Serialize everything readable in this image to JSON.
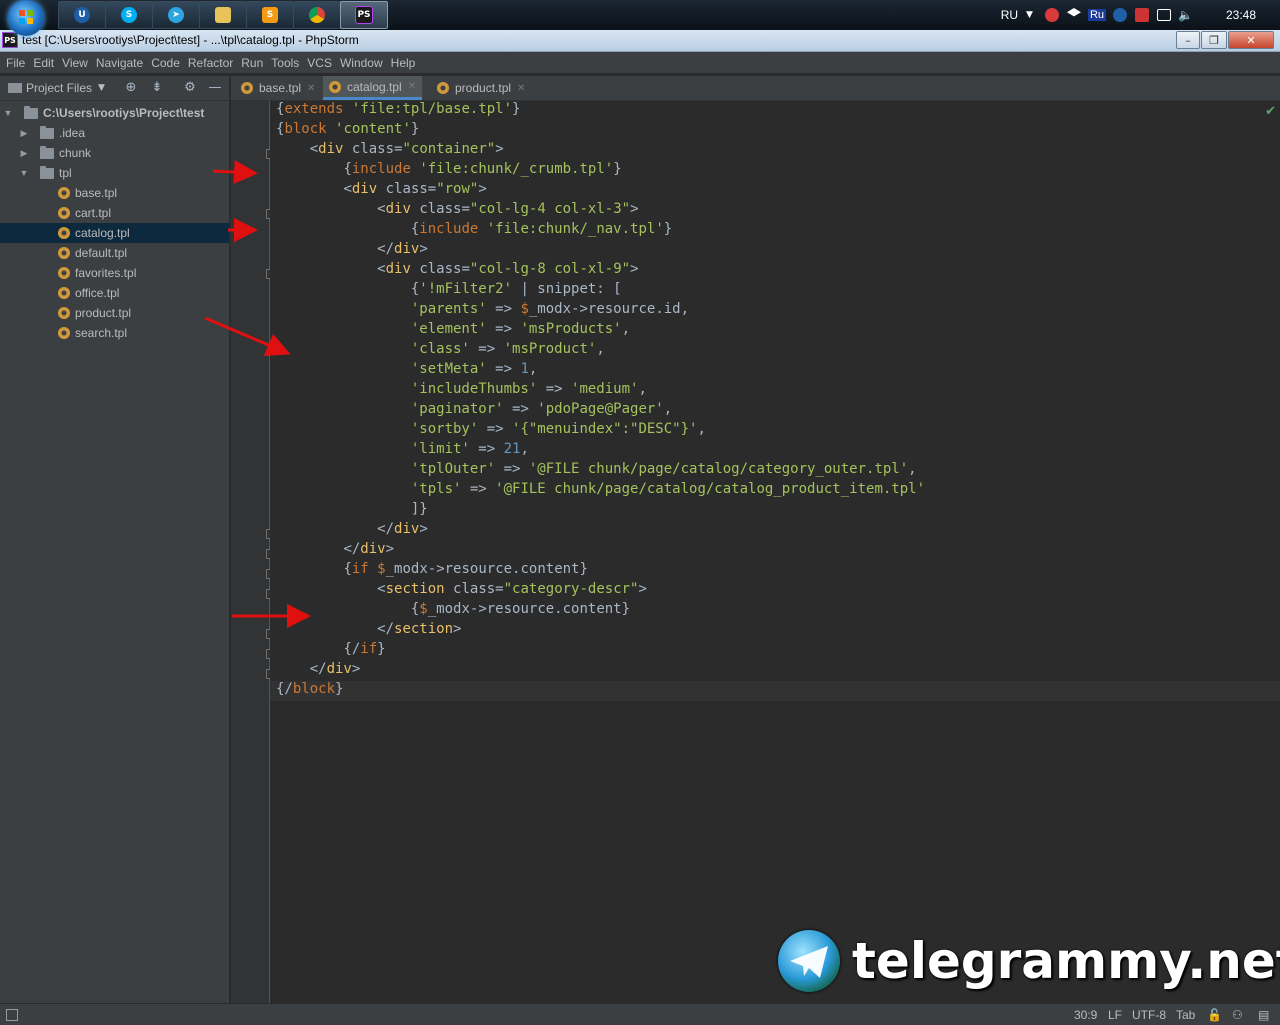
{
  "taskbar": {
    "language": "RU",
    "clock": "23:48",
    "ru_indicator": "Ru",
    "apps": [
      {
        "name": "uplay",
        "label": ""
      },
      {
        "name": "skype",
        "label": "S"
      },
      {
        "name": "telegram",
        "label": ""
      },
      {
        "name": "explorer",
        "label": ""
      },
      {
        "name": "sublime",
        "label": ""
      },
      {
        "name": "chrome",
        "label": ""
      },
      {
        "name": "phpstorm",
        "label": "PS"
      }
    ]
  },
  "window": {
    "title": "test [C:\\Users\\rootiys\\Project\\test] - ...\\tpl\\catalog.tpl - PhpStorm",
    "icon_label": "PS"
  },
  "menu": [
    "File",
    "Edit",
    "View",
    "Navigate",
    "Code",
    "Refactor",
    "Run",
    "Tools",
    "VCS",
    "Window",
    "Help"
  ],
  "project_panel": {
    "title": "Project Files",
    "tree": [
      {
        "label": "C:\\Users\\rootiys\\Project\\test",
        "type": "root"
      },
      {
        "label": ".idea",
        "type": "folder"
      },
      {
        "label": "chunk",
        "type": "folder"
      },
      {
        "label": "tpl",
        "type": "folder-open"
      },
      {
        "label": "base.tpl",
        "type": "file"
      },
      {
        "label": "cart.tpl",
        "type": "file"
      },
      {
        "label": "catalog.tpl",
        "type": "file",
        "selected": true
      },
      {
        "label": "default.tpl",
        "type": "file"
      },
      {
        "label": "favorites.tpl",
        "type": "file"
      },
      {
        "label": "office.tpl",
        "type": "file"
      },
      {
        "label": "product.tpl",
        "type": "file"
      },
      {
        "label": "search.tpl",
        "type": "file"
      }
    ]
  },
  "tabs": [
    {
      "label": "base.tpl",
      "active": false
    },
    {
      "label": "catalog.tpl",
      "active": true
    },
    {
      "label": "product.tpl",
      "active": false
    }
  ],
  "code": [
    "{extends 'file:tpl/base.tpl'}",
    "{block 'content'}",
    "    <div class=\"container\">",
    "        {include 'file:chunk/_crumb.tpl'}",
    "        <div class=\"row\">",
    "            <div class=\"col-lg-4 col-xl-3\">",
    "                {include 'file:chunk/_nav.tpl'}",
    "            </div>",
    "            <div class=\"col-lg-8 col-xl-9\">",
    "                {'!mFilter2' | snippet: [",
    "                'parents' => $_modx->resource.id,",
    "                'element' => 'msProducts',",
    "                'class' => 'msProduct',",
    "                'setMeta' => 1,",
    "                'includeThumbs' => 'medium',",
    "                'paginator' => 'pdoPage@Pager',",
    "                'sortby' => '{\"menuindex\":\"DESC\"}',",
    "                'limit' => 21,",
    "                'tplOuter' => '@FILE chunk/page/catalog/category_outer.tpl',",
    "                'tpls' => '@FILE chunk/page/catalog/catalog_product_item.tpl'",
    "                ]}",
    "            </div>",
    "        </div>",
    "        {if $_modx->resource.content}",
    "            <section class=\"category-descr\">",
    "                {$_modx->resource.content}",
    "            </section>",
    "        {/if}",
    "    </div>",
    "{/block}"
  ],
  "watermark": "telegrammy.net",
  "status": {
    "position": "30:9",
    "line_sep": "LF",
    "encoding": "UTF-8",
    "indent": "Tab"
  },
  "colors": {
    "editor_bg": "#2b2b2b",
    "tag": "#e8bf6a",
    "keyword": "#cc7832",
    "string": "#a5c25c",
    "number": "#6897bb",
    "arrow": "#e01010"
  }
}
